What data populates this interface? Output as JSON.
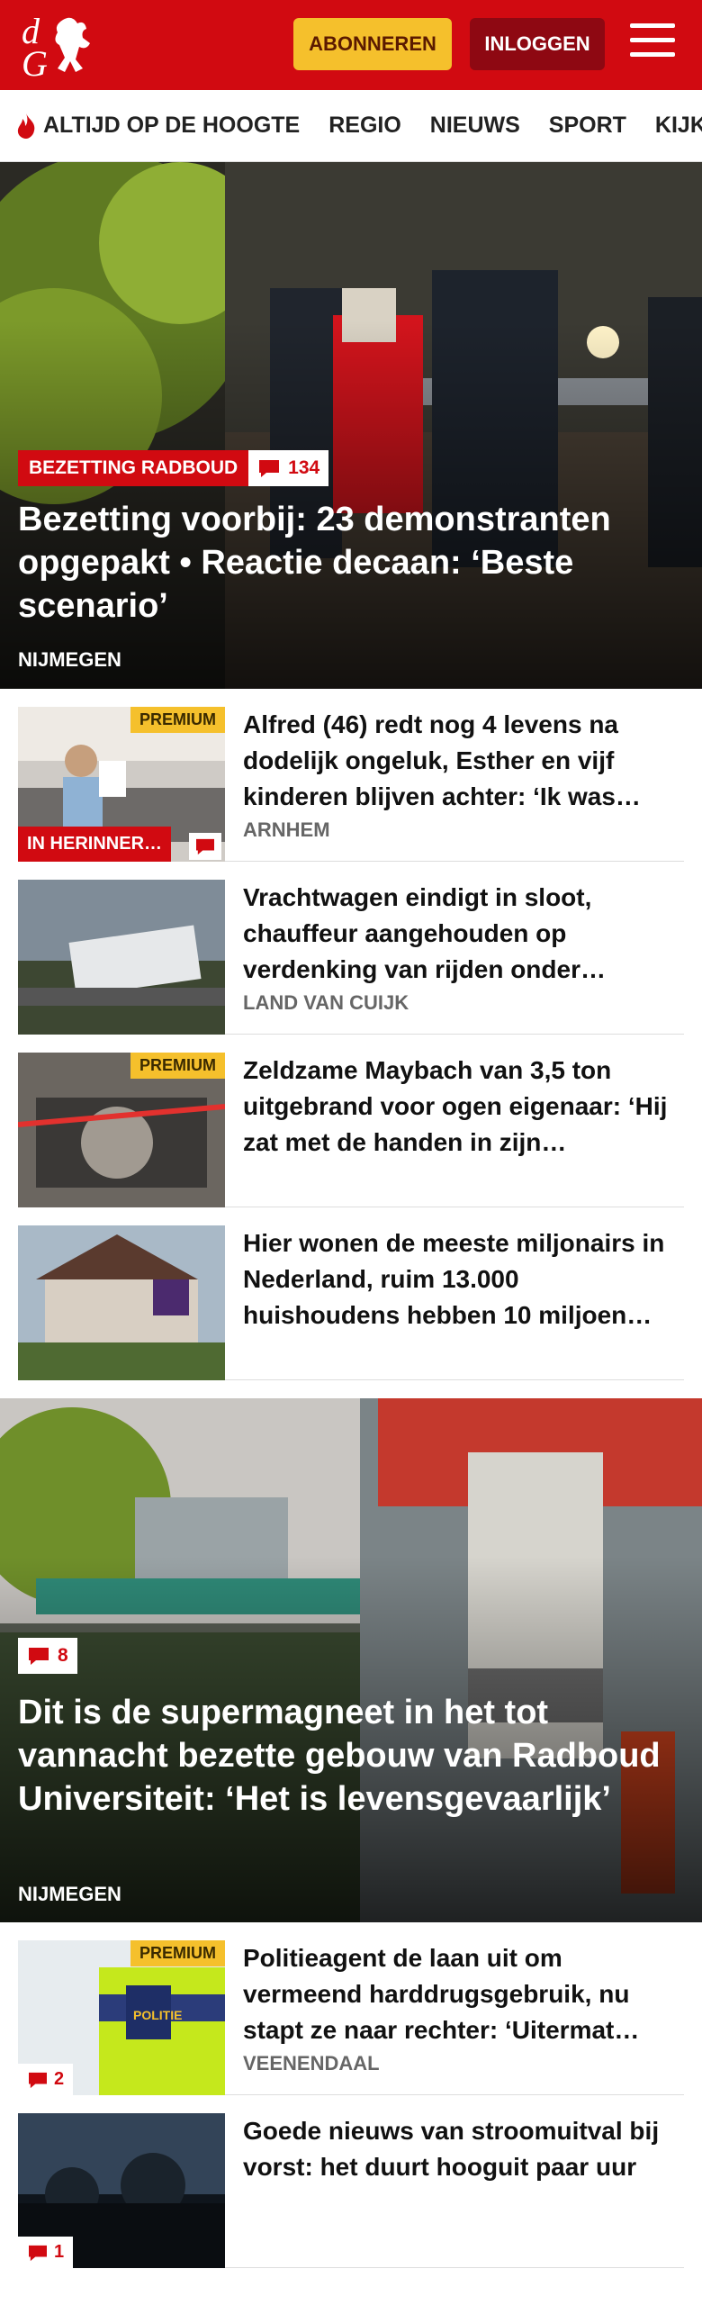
{
  "header": {
    "subscribe_label": "ABONNEREN",
    "login_label": "INLOGGEN",
    "brand_color": "#d10a11"
  },
  "nav": {
    "items": [
      {
        "label": "ALTIJD OP DE HOOGTE",
        "icon": "flame-icon"
      },
      {
        "label": "REGIO"
      },
      {
        "label": "NIEUWS"
      },
      {
        "label": "SPORT"
      },
      {
        "label": "KIJK"
      }
    ]
  },
  "hero1": {
    "tag": "BEZETTING RADBOUD",
    "comments": "134",
    "title": "Bezetting voorbij: 23 demonstranten opgepakt • Reactie decaan: ‘Beste scenario’",
    "location": "NIJMEGEN"
  },
  "list1": [
    {
      "title": "Alfred (46) redt nog 4 levens na dodelijk ongeluk, Esther en vijf kinderen blijven achter: ‘Ik was…",
      "location": "ARNHEM",
      "premium": "PREMIUM",
      "tag": "IN HERINNER…"
    },
    {
      "title": "Vrachtwagen eindigt in sloot, chauffeur aangehouden op verdenking van rijden onder…",
      "location": "LAND VAN CUIJK"
    },
    {
      "title": "Zeldzame Maybach van 3,5 ton uitgebrand voor ogen eigenaar: ‘Hij zat met de handen in zijn…",
      "premium": "PREMIUM"
    },
    {
      "title": "Hier wonen de meeste miljonairs in Nederland, ruim 13.000 huishoudens hebben 10 miljoen…"
    }
  ],
  "hero2": {
    "comments": "8",
    "title": "Dit is de supermagneet in het tot vannacht bezette gebouw van Radboud Universiteit: ‘Het is levensgevaarlijk’",
    "location": "NIJMEGEN"
  },
  "list2": [
    {
      "title": "Politieagent de laan uit om vermeend harddrugsgebruik, nu stapt ze naar rechter: ‘Uitermat…",
      "location": "VEENENDAAL",
      "premium": "PREMIUM",
      "comments": "2"
    },
    {
      "title": "Goede nieuws van stroomuitval bij vorst: het duurt hooguit paar uur",
      "comments": "1"
    }
  ]
}
